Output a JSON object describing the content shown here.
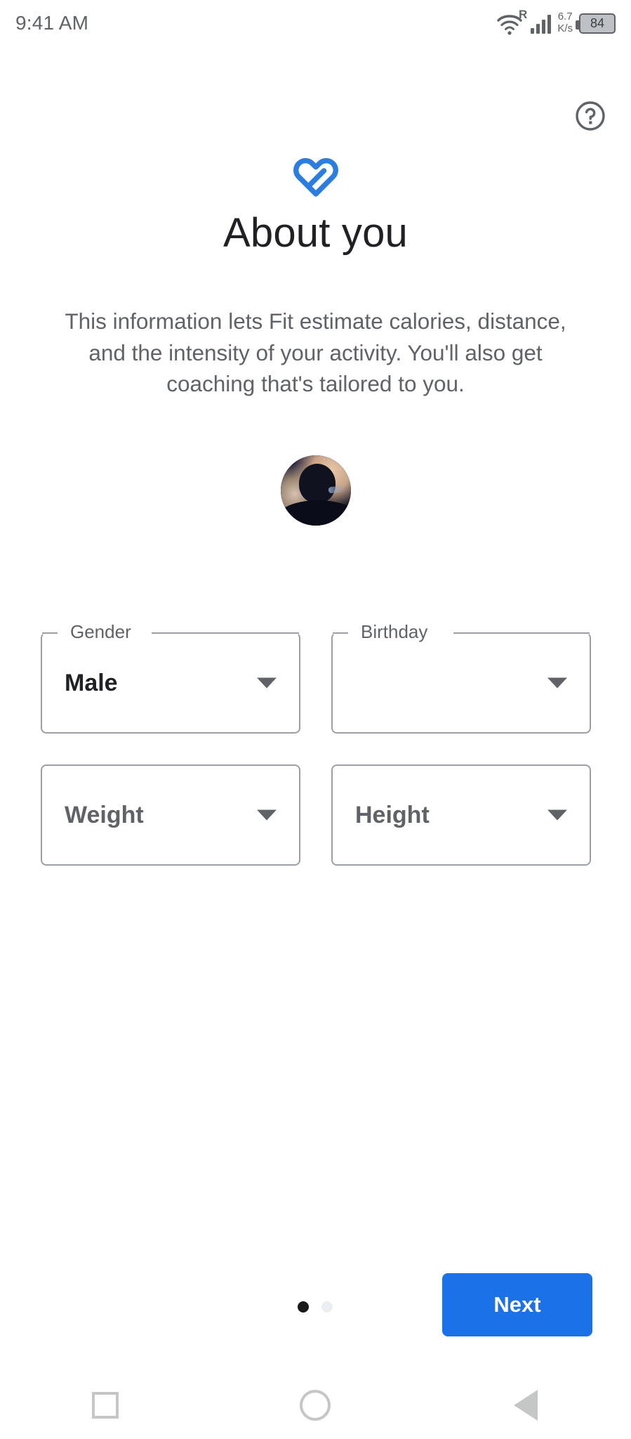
{
  "status_bar": {
    "time": "9:41 AM",
    "wifi_icon": "wifi-icon",
    "roaming_label": "R",
    "signal_icon": "signal-bars-icon",
    "network_speed_value": "6.7",
    "network_speed_unit": "K/s",
    "battery_level": "84"
  },
  "header": {
    "help_icon": "help-circle-icon",
    "logo_icon": "google-fit-heart-logo",
    "title": "About you",
    "description": "This information lets Fit estimate calories, distance, and the intensity of your activity. You'll also get coaching that's tailored to you.",
    "avatar": "user-avatar"
  },
  "form": {
    "fields": [
      {
        "name": "gender",
        "label": "Gender",
        "value": "Male",
        "placeholder": "Gender",
        "has_value": true,
        "caret_icon": "chevron-down-icon"
      },
      {
        "name": "birthday",
        "label": "Birthday",
        "value": "",
        "placeholder": "Birthday",
        "has_value": false,
        "caret_icon": "chevron-down-icon"
      },
      {
        "name": "weight",
        "label": "Weight",
        "value": "",
        "placeholder": "Weight",
        "has_value": false,
        "caret_icon": "chevron-down-icon"
      },
      {
        "name": "height",
        "label": "Height",
        "value": "",
        "placeholder": "Height",
        "has_value": false,
        "caret_icon": "chevron-down-icon"
      }
    ]
  },
  "footer": {
    "pager": {
      "total": 2,
      "active_index": 0
    },
    "next_label": "Next"
  },
  "nav_bar": {
    "recents_icon": "square-recents-icon",
    "home_icon": "circle-home-icon",
    "back_icon": "triangle-back-icon"
  },
  "colors": {
    "accent_blue": "#1b72e8",
    "logo_blue": "#2b7de0",
    "text_primary": "#202124",
    "text_secondary": "#5f6368",
    "field_border": "#9aa0a6",
    "nav_grey": "#c4c7c5"
  }
}
